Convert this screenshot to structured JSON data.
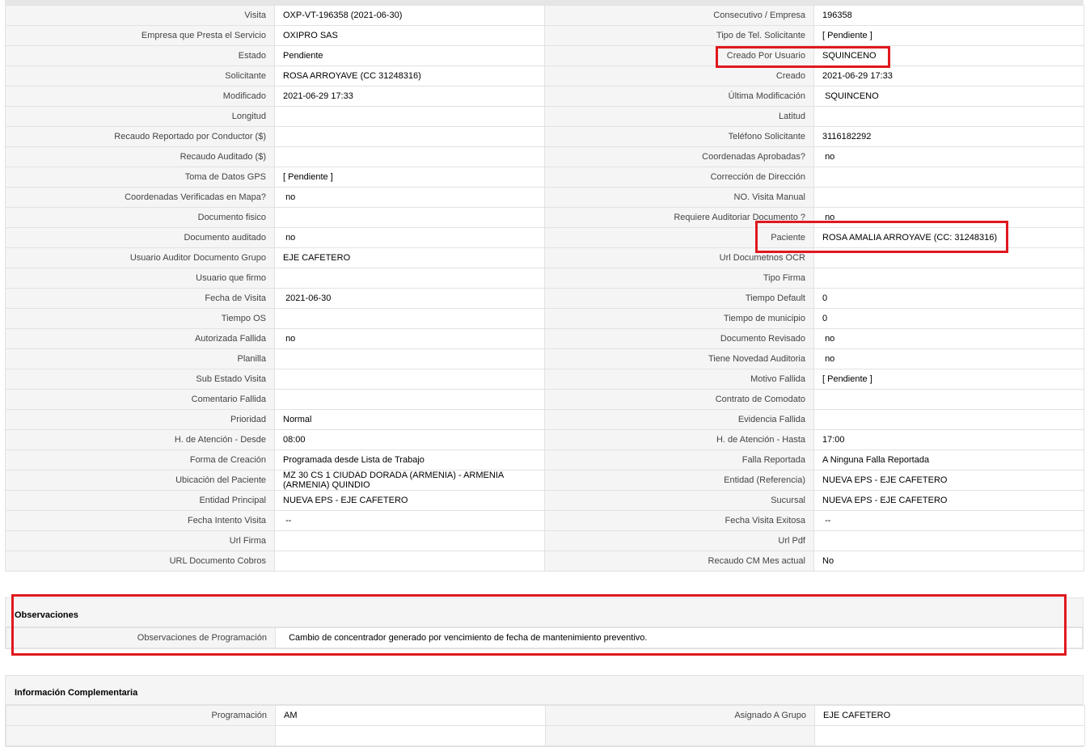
{
  "rows": [
    [
      "Visita",
      "OXP-VT-196358 (2021-06-30)",
      "Consecutivo / Empresa",
      "196358"
    ],
    [
      "Empresa que Presta el Servicio",
      "OXIPRO SAS",
      "Tipo de Tel. Solicitante",
      "[ Pendiente ]"
    ],
    [
      "Estado",
      "Pendiente",
      "Creado Por Usuario",
      "SQUINCENO"
    ],
    [
      "Solicitante",
      "ROSA ARROYAVE (CC 31248316)",
      "Creado",
      "2021-06-29 17:33"
    ],
    [
      "Modificado",
      "2021-06-29 17:33",
      "Última Modificación",
      " SQUINCENO"
    ],
    [
      "Longitud",
      "",
      "Latitud",
      ""
    ],
    [
      "Recaudo Reportado por Conductor ($)",
      "",
      "Teléfono Solicitante",
      "3116182292"
    ],
    [
      "Recaudo Auditado ($)",
      "",
      "Coordenadas Aprobadas?",
      " no"
    ],
    [
      "Toma de Datos GPS",
      "[ Pendiente ]",
      "Corrección de Dirección",
      ""
    ],
    [
      "Coordenadas Verificadas en Mapa?",
      " no",
      "NO. Visita Manual",
      ""
    ],
    [
      "Documento fisico",
      "",
      "Requiere Auditoriar Documento ?",
      " no"
    ],
    [
      "Documento auditado",
      " no",
      "Paciente",
      "ROSA AMALIA ARROYAVE (CC: 31248316)"
    ],
    [
      "Usuario Auditor Documento Grupo",
      "EJE CAFETERO",
      "Url Documetnos OCR",
      ""
    ],
    [
      "Usuario que firmo",
      "",
      "Tipo Firma",
      ""
    ],
    [
      "Fecha de Visita",
      " 2021-06-30",
      "Tiempo Default",
      "0"
    ],
    [
      "Tiempo OS",
      "",
      "Tiempo de municipio",
      "0"
    ],
    [
      "Autorizada Fallida",
      " no",
      "Documento Revisado",
      " no"
    ],
    [
      "Planilla",
      "",
      "Tiene Novedad Auditoria",
      " no"
    ],
    [
      "Sub Estado Visita",
      "",
      "Motivo Fallida",
      "[ Pendiente ]"
    ],
    [
      "Comentario Fallida",
      "",
      "Contrato de Comodato",
      ""
    ],
    [
      "Prioridad",
      "Normal",
      "Evidencia Fallida",
      ""
    ],
    [
      "H. de Atención - Desde",
      "08:00",
      "H. de Atención - Hasta",
      "17:00"
    ],
    [
      "Forma de Creación",
      "Programada desde Lista de Trabajo",
      "Falla Reportada",
      "A Ninguna Falla Reportada"
    ],
    [
      "Ubicación del Paciente",
      "MZ 30 CS 1 CIUDAD DORADA (ARMENIA) - ARMENIA (ARMENIA) QUINDIO",
      "Entidad (Referencia)",
      "NUEVA EPS - EJE CAFETERO"
    ],
    [
      "Entidad Principal",
      "NUEVA EPS - EJE CAFETERO",
      "Sucursal",
      "NUEVA EPS - EJE CAFETERO"
    ],
    [
      "Fecha Intento Visita",
      " --",
      "Fecha Visita Exitosa",
      " --"
    ],
    [
      "Url Firma",
      "",
      "Url Pdf",
      ""
    ],
    [
      "URL Documento Cobros",
      "",
      "Recaudo CM Mes actual",
      "No"
    ]
  ],
  "observaciones": {
    "title": "Observaciones",
    "label": "Observaciones de Programación",
    "value": "  Cambio de concentrador generado por vencimiento de fecha de mantenimiento preventivo."
  },
  "complementaria": {
    "title": "Información Complementaria",
    "label_left": "Programación",
    "value_left": "AM",
    "label_right": "Asignado A Grupo",
    "value_right": "EJE CAFETERO"
  },
  "colors": {
    "highlight": "#e0181e",
    "label_bg": "#f5f5f5",
    "border": "#e2e2e2"
  }
}
